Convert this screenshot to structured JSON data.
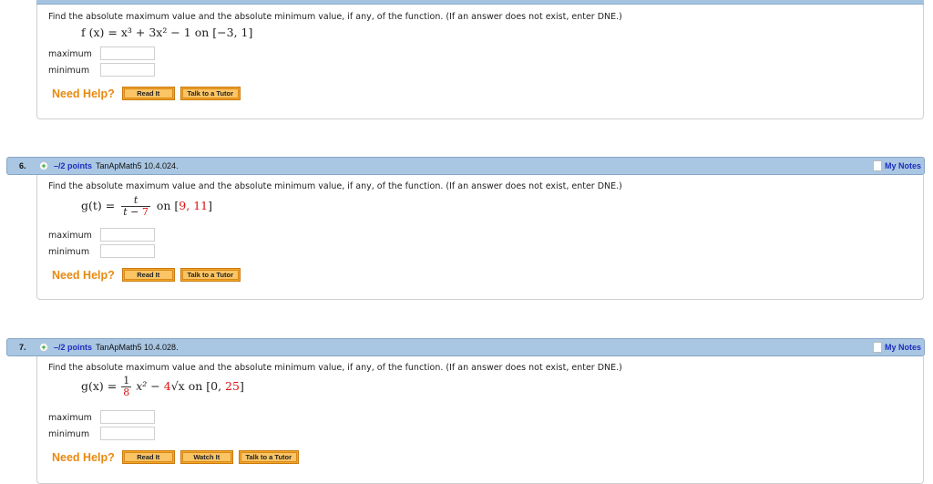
{
  "prompt_text": "Find the absolute maximum value and the absolute minimum value, if any, of the function. (If an answer does not exist, enter DNE.)",
  "labels": {
    "maximum": "maximum",
    "minimum": "minimum",
    "need_help": "Need Help?",
    "read_it": "Read It",
    "watch_it": "Watch It",
    "talk_tutor": "Talk to a Tutor",
    "my_notes": "My Notes"
  },
  "questions": [
    {
      "formula": {
        "lhs": "f (x) =",
        "expr": "x³ + 3x² − 1",
        "on": "on",
        "interval": "[−3, 1]"
      },
      "answers": {
        "maximum": "",
        "minimum": ""
      }
    },
    {
      "number": "6.",
      "points": "–/2 points",
      "source": "TanApMath5 10.4.024.",
      "formula": {
        "lhs": "g(t) =",
        "numerator": "t",
        "den_prefix": "t − ",
        "den_const": "7",
        "on": "on",
        "interval_open": "[",
        "interval_a": "9",
        "interval_sep": ", ",
        "interval_b": "11",
        "interval_close": "]"
      },
      "answers": {
        "maximum": "",
        "minimum": ""
      }
    },
    {
      "number": "7.",
      "points": "–/2 points",
      "source": "TanApMath5 10.4.028.",
      "formula": {
        "lhs": "g(x) =",
        "numerator": "1",
        "denominator": "8",
        "term1": "x² −",
        "coef": "4",
        "sqrt": "√x",
        "on": "on",
        "interval_open": "[0, ",
        "interval_b": "25",
        "interval_close": "]"
      },
      "answers": {
        "maximum": "",
        "minimum": ""
      }
    }
  ]
}
